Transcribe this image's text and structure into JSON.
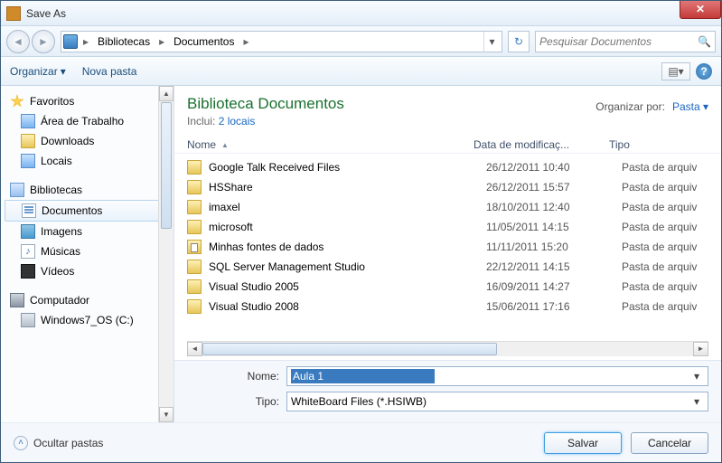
{
  "title": "Save As",
  "breadcrumb": {
    "root_chev": "▸",
    "seg1": "Bibliotecas",
    "chev": "▸",
    "seg2": "Documentos",
    "chev2": "▸",
    "drop": "▾"
  },
  "refresh_glyph": "↻",
  "search": {
    "placeholder": "Pesquisar Documentos",
    "icon": "🔍"
  },
  "toolbar": {
    "organize": "Organizar",
    "caret": "▾",
    "newfolder": "Nova pasta",
    "view_glyph": "▤",
    "help": "?"
  },
  "sidebar": {
    "favorites": "Favoritos",
    "desktop": "Área de Trabalho",
    "downloads": "Downloads",
    "locais": "Locais",
    "libraries": "Bibliotecas",
    "documents": "Documentos",
    "images": "Imagens",
    "music": "Músicas",
    "music_glyph": "♪",
    "videos": "Vídeos",
    "computer": "Computador",
    "drive": "Windows7_OS (C:)"
  },
  "main": {
    "heading": "Biblioteca Documentos",
    "sub_label": "Inclui:",
    "sub_link": "2 locais",
    "arrange_label": "Organizar por:",
    "arrange_value": "Pasta",
    "arrange_caret": "▾"
  },
  "cols": {
    "name": "Nome",
    "sort": "▲",
    "date": "Data de modificaç...",
    "type": "Tipo"
  },
  "rows": [
    {
      "name": "Google Talk Received Files",
      "date": "26/12/2011 10:40",
      "type": "Pasta de arquiv",
      "icon": "folder"
    },
    {
      "name": "HSShare",
      "date": "26/12/2011 15:57",
      "type": "Pasta de arquiv",
      "icon": "folder"
    },
    {
      "name": "imaxel",
      "date": "18/10/2011 12:40",
      "type": "Pasta de arquiv",
      "icon": "folder"
    },
    {
      "name": "microsoft",
      "date": "11/05/2011 14:15",
      "type": "Pasta de arquiv",
      "icon": "folder"
    },
    {
      "name": "Minhas fontes de dados",
      "date": "11/11/2011 15:20",
      "type": "Pasta de arquiv",
      "icon": "dbfolder"
    },
    {
      "name": "SQL Server Management Studio",
      "date": "22/12/2011 14:15",
      "type": "Pasta de arquiv",
      "icon": "folder"
    },
    {
      "name": "Visual Studio 2005",
      "date": "16/09/2011 14:27",
      "type": "Pasta de arquiv",
      "icon": "folder"
    },
    {
      "name": "Visual Studio 2008",
      "date": "15/06/2011 17:16",
      "type": "Pasta de arquiv",
      "icon": "folder"
    }
  ],
  "fields": {
    "name_label": "Nome:",
    "name_value": "Aula 1",
    "type_label": "Tipo:",
    "type_value": "WhiteBoard Files (*.HSIWB)"
  },
  "bottom": {
    "hide": "Ocultar pastas",
    "hide_glyph": "˄",
    "save": "Salvar",
    "cancel": "Cancelar"
  },
  "close_glyph": "✕",
  "arrow_left": "◄",
  "arrow_right": "►",
  "arrow_up": "▲",
  "arrow_down": "▼"
}
